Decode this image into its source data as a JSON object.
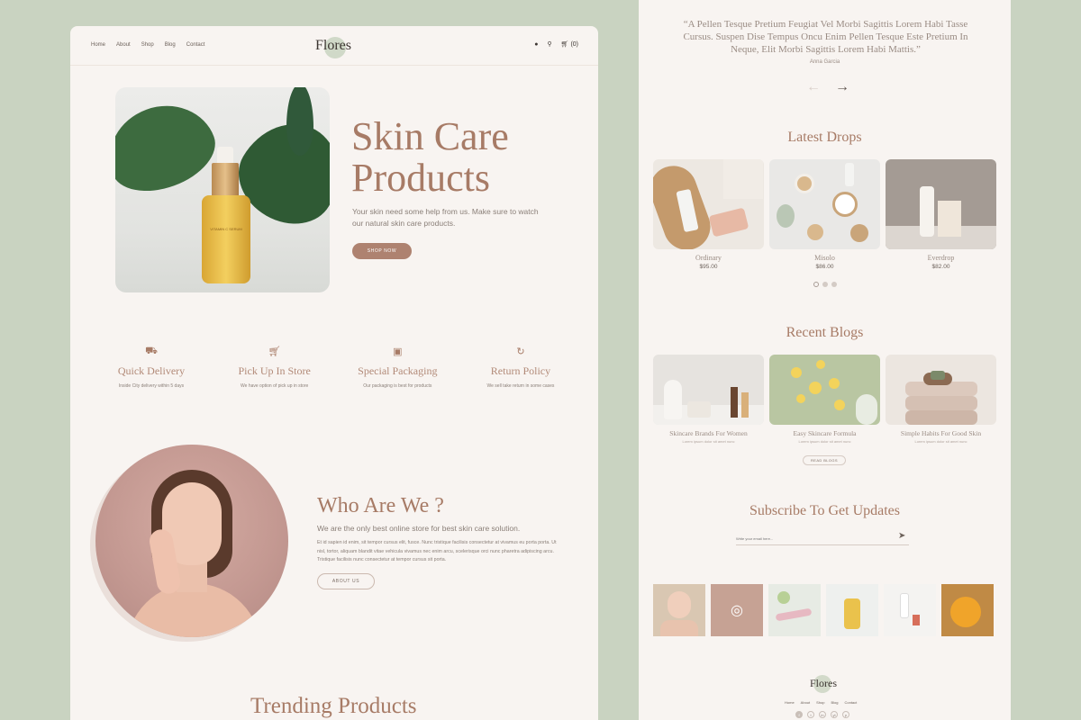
{
  "left": {
    "nav": {
      "links": [
        "Home",
        "About",
        "Shop",
        "Blog",
        "Contact"
      ],
      "logo": "Flores",
      "cart": "(0)",
      "icons": [
        "user-icon",
        "search-icon",
        "cart-icon"
      ]
    },
    "hero": {
      "title_line1": "Skin Care",
      "title_line2": "Products",
      "subtitle": "Your skin need some help from us. Make sure to watch our natural skin care products.",
      "button": "SHOP NOW",
      "bottle_label": "VITAMIN C SERUM"
    },
    "features": [
      {
        "icon": "truck-icon",
        "title": "Quick Delivery",
        "desc": "Inside City delivery within 5 days"
      },
      {
        "icon": "cart-icon",
        "title": "Pick Up In Store",
        "desc": "We have option of pick up in store"
      },
      {
        "icon": "gift-icon",
        "title": "Special Packaging",
        "desc": "Our packaging is best for products"
      },
      {
        "icon": "refresh-icon",
        "title": "Return Policy",
        "desc": "We sell take return in some cases"
      }
    ],
    "about": {
      "title": "Who Are We ?",
      "lead": "We are the only best online store for best skin care solution.",
      "body": "Et id sapien id enim, sit tempor cursus elit, fusce. Nunc tristique facilisis consectetur at vivamus eu porta porta. Ut nisl, tortor, aliquam blandit vitae vehicula vivamus nec enim arcu, scelerisque orci nunc pharetra adipiscing arcu. Tristique facilisis nunc consectetur at tempor cursus sit porta.",
      "button": "ABOUT US"
    },
    "trending_title": "Trending Products"
  },
  "right": {
    "testimonial": {
      "quote": "“A Pellen Tesque Pretium Feugiat Vel Morbi Sagittis Lorem Habi Tasse Cursus. Suspen Dise Tempus Oncu Enim Pellen Tesque Este Pretium In Neque, Elit Morbi Sagittis Lorem Habi Mattis.”",
      "author": "Anna Garcia",
      "prev": "←",
      "next": "→"
    },
    "latest_drops": {
      "title": "Latest Drops",
      "items": [
        {
          "name": "Ordinary",
          "price": "$95.00"
        },
        {
          "name": "Misolo",
          "price": "$86.00"
        },
        {
          "name": "Everdrop",
          "price": "$82.00"
        }
      ]
    },
    "recent_blogs": {
      "title": "Recent Blogs",
      "items": [
        {
          "name": "Skincare Brands For Women",
          "meta": "Lorem ipsum dolor sit amet nunc"
        },
        {
          "name": "Easy Skincare Formula",
          "meta": "Lorem ipsum dolor sit amet nunc"
        },
        {
          "name": "Simple Habits For Good Skin",
          "meta": "Lorem ipsum dolor sit amet nunc"
        }
      ],
      "button": "READ BLOGS"
    },
    "subscribe": {
      "title": "Subscribe To Get Updates",
      "placeholder": "Write your email here..."
    },
    "footer": {
      "logo": "Flores",
      "links": [
        "Home",
        "About",
        "Shop",
        "Blog",
        "Contact"
      ],
      "socials": [
        "f",
        "t",
        "in",
        "yt",
        "p"
      ]
    }
  },
  "colors": {
    "background": "#c9d3c1",
    "page": "#f8f4f1",
    "accent": "#a77b66",
    "button": "#ae8270"
  }
}
